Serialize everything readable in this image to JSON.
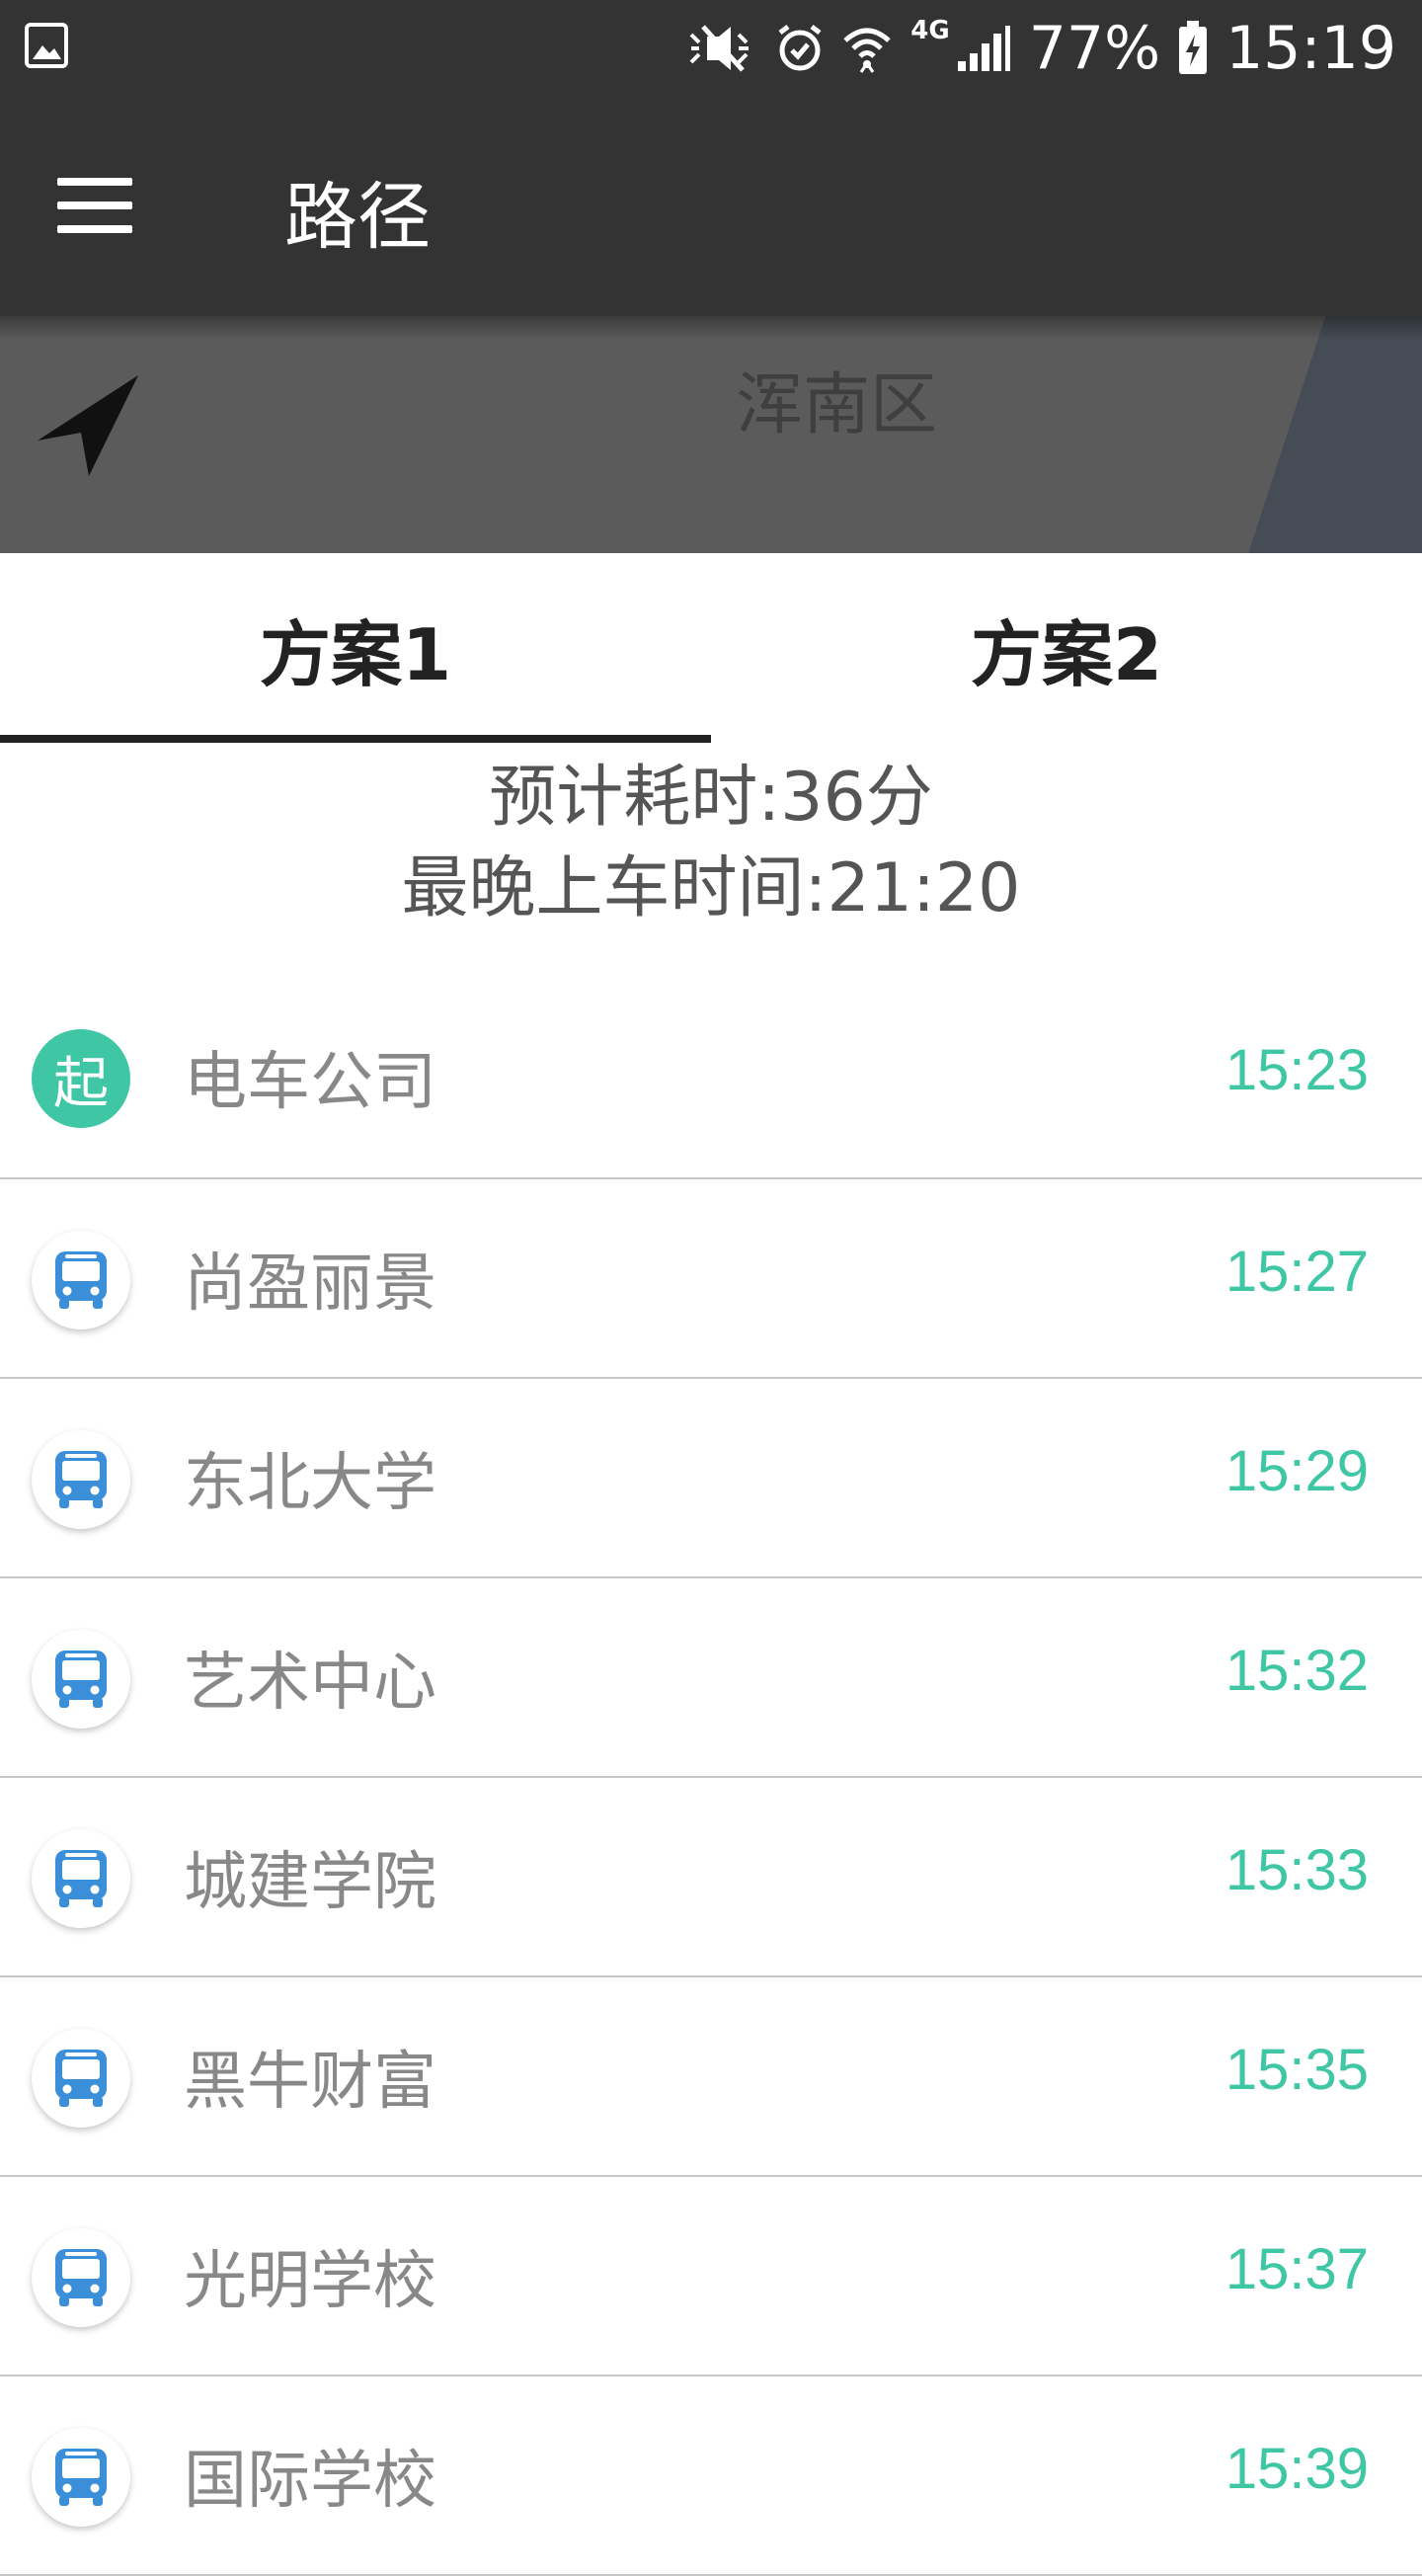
{
  "status_bar": {
    "battery_percent": "77%",
    "network_type": "4G",
    "time": "15:19",
    "icons": [
      "gallery-icon",
      "mute-icon",
      "alarm-icon",
      "wifi-icon",
      "signal-icon",
      "battery-charging-icon"
    ]
  },
  "app_bar": {
    "title": "路径",
    "menu_icon": "menu-icon"
  },
  "map": {
    "district_label": "浑南区",
    "locate_icon": "navigation-arrow-icon"
  },
  "tabs": [
    {
      "label": "方案1",
      "selected": true
    },
    {
      "label": "方案2",
      "selected": false
    }
  ],
  "summary": {
    "estimated_time": "预计耗时:36分",
    "last_boarding": "最晚上车时间:21:20"
  },
  "stops": [
    {
      "icon": "start",
      "icon_text": "起",
      "name": "电车公司",
      "time": "15:23"
    },
    {
      "icon": "bus",
      "name": "尚盈丽景",
      "time": "15:27"
    },
    {
      "icon": "bus",
      "name": "东北大学",
      "time": "15:29"
    },
    {
      "icon": "bus",
      "name": "艺术中心",
      "time": "15:32"
    },
    {
      "icon": "bus",
      "name": "城建学院",
      "time": "15:33"
    },
    {
      "icon": "bus",
      "name": "黑牛财富",
      "time": "15:35"
    },
    {
      "icon": "bus",
      "name": "光明学校",
      "time": "15:37"
    },
    {
      "icon": "bus",
      "name": "国际学校",
      "time": "15:39"
    }
  ],
  "colors": {
    "header_bg": "#333333",
    "accent_green": "#3ec6a5",
    "bus_blue": "#3a8fd8",
    "stop_name": "#888888"
  }
}
